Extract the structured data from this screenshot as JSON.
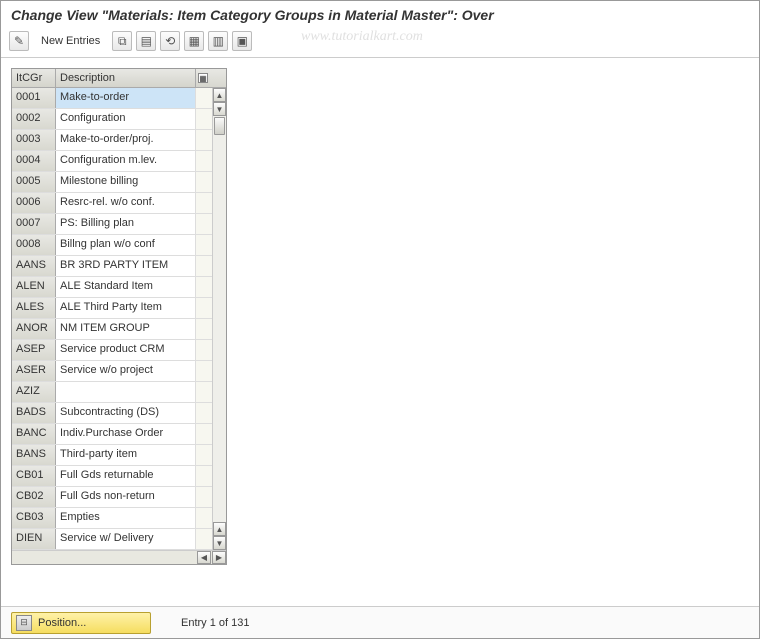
{
  "title": "Change View \"Materials: Item Category Groups in Material Master\": Over",
  "toolbar": {
    "new_entries_label": "New Entries"
  },
  "watermark": "www.tutorialkart.com",
  "table": {
    "headers": {
      "code": "ItCGr",
      "desc": "Description"
    },
    "rows": [
      {
        "code": "0001",
        "desc": "Make-to-order",
        "selected": true
      },
      {
        "code": "0002",
        "desc": "Configuration"
      },
      {
        "code": "0003",
        "desc": "Make-to-order/proj."
      },
      {
        "code": "0004",
        "desc": "Configuration m.lev."
      },
      {
        "code": "0005",
        "desc": "Milestone billing"
      },
      {
        "code": "0006",
        "desc": "Resrc-rel. w/o conf."
      },
      {
        "code": "0007",
        "desc": "PS: Billing plan"
      },
      {
        "code": "0008",
        "desc": "Billng plan w/o conf"
      },
      {
        "code": "AANS",
        "desc": "BR 3RD PARTY ITEM"
      },
      {
        "code": "ALEN",
        "desc": "ALE Standard Item"
      },
      {
        "code": "ALES",
        "desc": "ALE Third Party Item"
      },
      {
        "code": "ANOR",
        "desc": "NM ITEM GROUP"
      },
      {
        "code": "ASEP",
        "desc": "Service product CRM"
      },
      {
        "code": "ASER",
        "desc": "Service w/o project"
      },
      {
        "code": "AZIZ",
        "desc": ""
      },
      {
        "code": "BADS",
        "desc": "Subcontracting (DS)"
      },
      {
        "code": "BANC",
        "desc": "Indiv.Purchase Order"
      },
      {
        "code": "BANS",
        "desc": "Third-party item"
      },
      {
        "code": "CB01",
        "desc": "Full Gds returnable"
      },
      {
        "code": "CB02",
        "desc": "Full Gds non-return"
      },
      {
        "code": "CB03",
        "desc": "Empties"
      },
      {
        "code": "DIEN",
        "desc": "Service w/ Delivery"
      }
    ]
  },
  "footer": {
    "position_label": "Position...",
    "entry_status": "Entry 1 of 131"
  }
}
